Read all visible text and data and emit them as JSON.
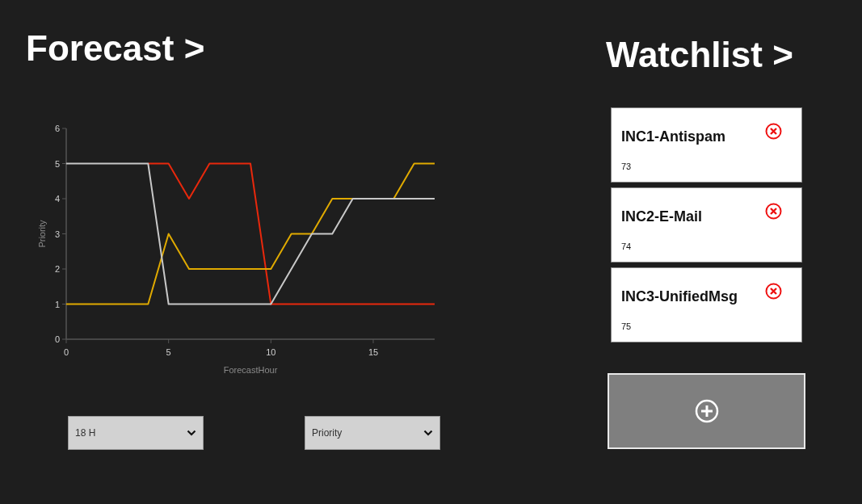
{
  "forecast": {
    "title": "Forecast >",
    "chart_data": {
      "type": "line",
      "xlabel": "ForecastHour",
      "ylabel": "Priority",
      "x": [
        0,
        1,
        2,
        3,
        4,
        5,
        6,
        7,
        8,
        9,
        10,
        11,
        12,
        13,
        14,
        15,
        16,
        17,
        18
      ],
      "xlim": [
        0,
        18
      ],
      "ylim": [
        0,
        6
      ],
      "xticks": [
        0,
        5,
        10,
        15
      ],
      "yticks": [
        0,
        1,
        2,
        3,
        4,
        5,
        6
      ],
      "series": [
        {
          "color": "#e8280c",
          "values": [
            null,
            null,
            null,
            null,
            5,
            5,
            4,
            5,
            5,
            5,
            1,
            1,
            1,
            1,
            1,
            1,
            1,
            1,
            1
          ]
        },
        {
          "color": "#e0aa00",
          "values": [
            1,
            1,
            1,
            1,
            1,
            3,
            2,
            2,
            2,
            2,
            2,
            3,
            3,
            4,
            4,
            null,
            4,
            5,
            5
          ]
        },
        {
          "color": "#c8c8c8",
          "values": [
            5,
            5,
            5,
            5,
            5,
            1,
            1,
            1,
            1,
            1,
            1,
            2,
            3,
            3,
            4,
            4,
            4,
            4,
            4
          ]
        }
      ]
    },
    "dropdowns": [
      {
        "value": "18 H"
      },
      {
        "value": "Priority"
      }
    ]
  },
  "watchlist": {
    "title": "Watchlist >",
    "items": [
      {
        "name": "INC1-Antispam",
        "number": "73"
      },
      {
        "name": "INC2-E-Mail",
        "number": "74"
      },
      {
        "name": "INC3-UnifiedMsg",
        "number": "75"
      }
    ]
  }
}
